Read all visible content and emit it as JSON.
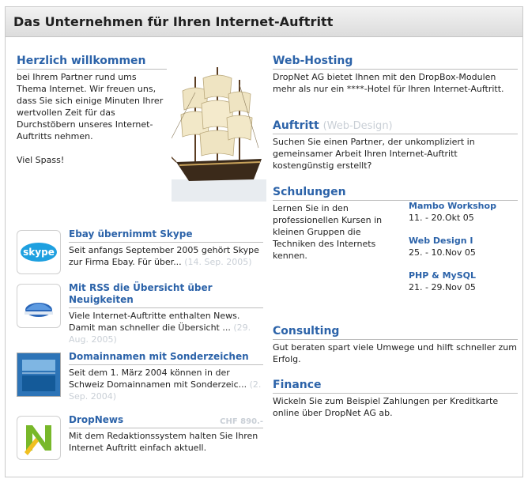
{
  "header": {
    "title": "Das Unternehmen für Ihren Internet-Auftritt"
  },
  "welcome": {
    "title": "Herzlich willkommen",
    "text": "bei Ihrem Partner rund ums Thema Internet. Wir freuen uns, dass Sie sich einige Minuten Ihrer wertvollen Zeit für das Durchstöbern unseres Internet-Auftritts nehmen.",
    "greeting": "Viel Spass!"
  },
  "news": [
    {
      "icon": "skype-logo",
      "title": "Ebay übernimmt Skype",
      "text": "Seit anfangs September 2005 gehört Skype zur Firma Ebay. Für über...",
      "date": "(14. Sep. 2005)"
    },
    {
      "icon": "rss-globe",
      "title": "Mit RSS die Übersicht über Neuigkeiten",
      "text": "Viele Internet-Auftritte enthalten News. Damit man schneller die Übersicht ...",
      "date": "(29. Aug. 2005)"
    },
    {
      "icon": "domain-book",
      "title": "Domainnamen mit Sonderzeichen",
      "text": "Seit dem 1. März 2004 können in der Schweiz Domainnamen mit Sonderzeic...",
      "date": "(2. Sep. 2004)"
    },
    {
      "icon": "dropnews-logo",
      "title": "DropNews",
      "price": "CHF 890.-",
      "text": "Mit dem Redaktionssystem halten Sie Ihren Internet Auftritt einfach aktuell.",
      "date": ""
    }
  ],
  "webhosting": {
    "title": "Web-Hosting",
    "text": "DropNet AG bietet Ihnen mit den DropBox-Modulen mehr als nur ein ****-Hotel für Ihren Internet-Auftritt."
  },
  "auftritt": {
    "title": "Auftritt",
    "subtitle": "(Web-Design)",
    "text": "Suchen Sie einen Partner, der unkompliziert in gemeinsamer Arbeit Ihren Internet-Auftritt kostengünstig erstellt?"
  },
  "schulungen": {
    "title": "Schulungen",
    "text": "Lernen Sie in den professionellen Kursen in kleinen Gruppen die Techniken des Internets kennen.",
    "courses": [
      {
        "name": "Mambo Workshop",
        "dates": "11. - 20.Okt 05"
      },
      {
        "name": "Web Design I",
        "dates": "25. - 10.Nov 05"
      },
      {
        "name": "PHP & MySQL",
        "dates": "21. - 29.Nov 05"
      }
    ]
  },
  "consulting": {
    "title": "Consulting",
    "text": "Gut beraten spart viele Umwege und hilft schneller zum Erfolg."
  },
  "finance": {
    "title": "Finance",
    "text": "Wickeln Sie zum Beispiel Zahlungen per Kreditkarte online über DropNet AG ab."
  },
  "colors": {
    "accent": "#2c63a9",
    "muted": "#c9cfd6",
    "header_bg": "#e4e4e4"
  }
}
